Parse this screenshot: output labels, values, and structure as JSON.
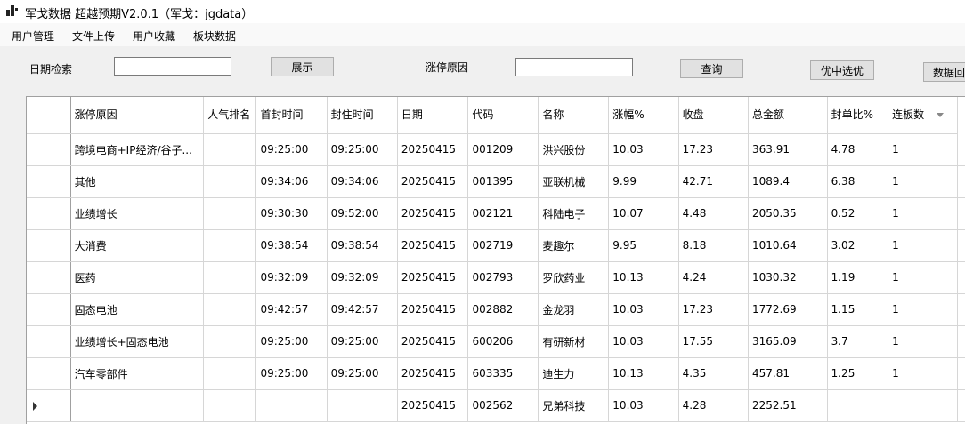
{
  "window": {
    "title": "军戈数据 超越预期V2.0.1（军戈：jgdata）"
  },
  "menu": [
    "用户管理",
    "文件上传",
    "用户收藏",
    "板块数据"
  ],
  "toolbar": {
    "date_label": "日期检索",
    "date_value": "",
    "show_button": "展示",
    "reason_label": "涨停原因",
    "reason_value": "",
    "query_button": "查询",
    "select_button": "优中选优",
    "data_button": "数据回"
  },
  "grid": {
    "columns": [
      "涨停原因",
      "人气排名",
      "首封时间",
      "封住时间",
      "日期",
      "代码",
      "名称",
      "涨幅%",
      "收盘",
      "总金额",
      "封单比%",
      "连板数"
    ],
    "rows": [
      [
        "跨境电商+IP经济/谷子...",
        "",
        "09:25:00",
        "09:25:00",
        "20250415",
        "001209",
        "洪兴股份",
        "10.03",
        "17.23",
        "363.91",
        "4.78",
        "1"
      ],
      [
        "其他",
        "",
        "09:34:06",
        "09:34:06",
        "20250415",
        "001395",
        "亚联机械",
        "9.99",
        "42.71",
        "1089.4",
        "6.38",
        "1"
      ],
      [
        "业绩增长",
        "",
        "09:30:30",
        "09:52:00",
        "20250415",
        "002121",
        "科陆电子",
        "10.07",
        "4.48",
        "2050.35",
        "0.52",
        "1"
      ],
      [
        "大消费",
        "",
        "09:38:54",
        "09:38:54",
        "20250415",
        "002719",
        "麦趣尔",
        "9.95",
        "8.18",
        "1010.64",
        "3.02",
        "1"
      ],
      [
        "医药",
        "",
        "09:32:09",
        "09:32:09",
        "20250415",
        "002793",
        "罗欣药业",
        "10.13",
        "4.24",
        "1030.32",
        "1.19",
        "1"
      ],
      [
        "固态电池",
        "",
        "09:42:57",
        "09:42:57",
        "20250415",
        "002882",
        "金龙羽",
        "10.03",
        "17.23",
        "1772.69",
        "1.15",
        "1"
      ],
      [
        "业绩增长+固态电池",
        "",
        "09:25:00",
        "09:25:00",
        "20250415",
        "600206",
        "有研新材",
        "10.03",
        "17.55",
        "3165.09",
        "3.7",
        "1"
      ],
      [
        "汽车零部件",
        "",
        "09:25:00",
        "09:25:00",
        "20250415",
        "603335",
        "迪生力",
        "10.13",
        "4.35",
        "457.81",
        "1.25",
        "1"
      ],
      [
        "",
        "",
        "",
        "",
        "20250415",
        "002562",
        "兄弟科技",
        "10.03",
        "4.28",
        "2252.51",
        "",
        ""
      ]
    ]
  }
}
